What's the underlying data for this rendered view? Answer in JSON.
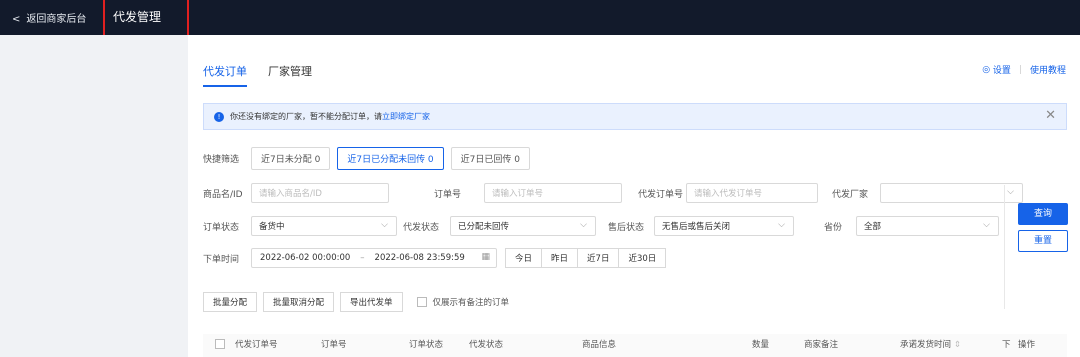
{
  "topbar": {
    "back_label": "返回商家后台",
    "title": "代发管理"
  },
  "tabs": [
    {
      "label": "代发订单"
    },
    {
      "label": "厂家管理"
    }
  ],
  "top_links": {
    "settings": "设置",
    "tutorial": "使用教程"
  },
  "notice": {
    "text": "你还没有绑定的厂家，暂不能分配订单，请",
    "link": "立即绑定厂家"
  },
  "quick_filter": {
    "label": "快捷筛选",
    "options": [
      "近7日未分配 0",
      "近7日已分配未回传 0",
      "近7日已回传 0"
    ],
    "selected": 1
  },
  "filters": {
    "product_label": "商品名/ID",
    "product_placeholder": "请输入商品名/ID",
    "order_no_label": "订单号",
    "order_no_placeholder": "请输入订单号",
    "dropship_order_label": "代发订单号",
    "dropship_order_placeholder": "请输入代发订单号",
    "factory_label": "代发厂家",
    "order_status_label": "订单状态",
    "order_status_value": "备货中",
    "dropship_status_label": "代发状态",
    "dropship_status_value": "已分配未回传",
    "aftersale_label": "售后状态",
    "aftersale_value": "无售后或售后关闭",
    "province_label": "省份",
    "province_value": "全部",
    "time_label": "下单时间",
    "time_start": "2022-06-02 00:00:00",
    "time_end": "2022-06-08 23:59:59",
    "date_buttons": [
      "今日",
      "昨日",
      "近7日",
      "近30日"
    ]
  },
  "buttons": {
    "query": "查询",
    "reset": "重置"
  },
  "actions": {
    "batch_assign": "批量分配",
    "batch_cancel": "批量取消分配",
    "export": "导出代发单",
    "only_remark": "仅展示有备注的订单"
  },
  "table_headers": [
    "代发订单号",
    "订单号",
    "订单状态",
    "代发状态",
    "商品信息",
    "数量",
    "商家备注",
    "承诺发货时间",
    "下",
    "操作"
  ]
}
